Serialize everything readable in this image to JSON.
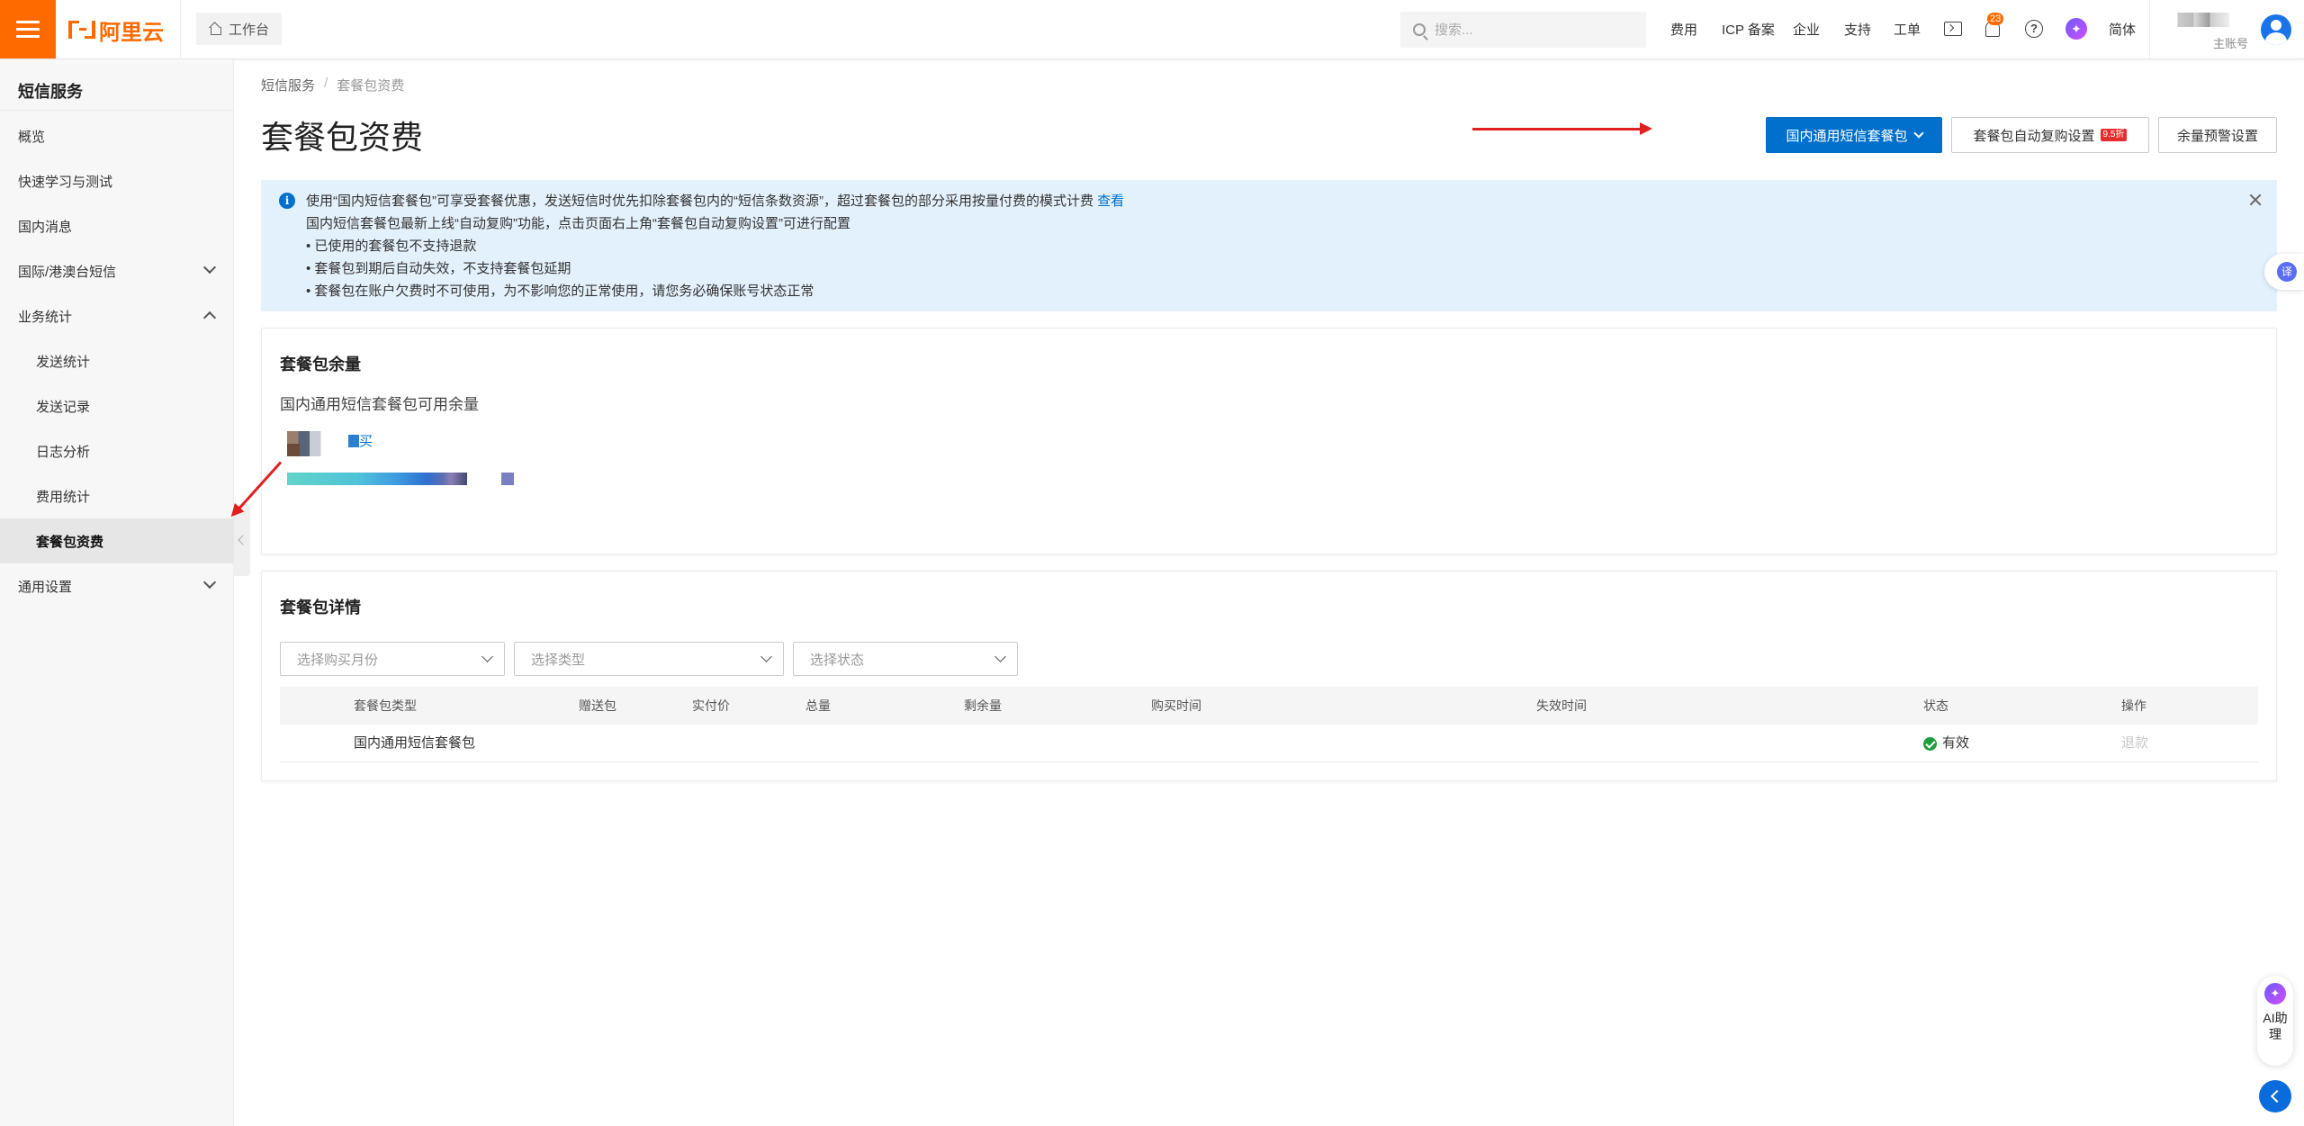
{
  "topbar": {
    "brand": "阿里云",
    "workbench": "工作台",
    "search_placeholder": "搜索...",
    "nav": [
      "费用",
      "ICP 备案",
      "企业",
      "支持",
      "工单"
    ],
    "notification_count": "23",
    "language": "简体",
    "account_role": "主账号"
  },
  "sidebar": {
    "title": "短信服务",
    "items": [
      {
        "label": "概览"
      },
      {
        "label": "快速学习与测试"
      },
      {
        "label": "国内消息"
      },
      {
        "label": "国际/港澳台短信"
      },
      {
        "label": "业务统计"
      },
      {
        "label": "发送统计"
      },
      {
        "label": "发送记录"
      },
      {
        "label": "日志分析"
      },
      {
        "label": "费用统计"
      },
      {
        "label": "套餐包资费"
      },
      {
        "label": "通用设置"
      }
    ]
  },
  "breadcrumb": {
    "root": "短信服务",
    "sep": "/",
    "current": "套餐包资费"
  },
  "page": {
    "title": "套餐包资费",
    "primary_button": "国内通用短信套餐包",
    "auto_renew_button": "套餐包自动复购设置",
    "discount_badge": "9.5折",
    "alert_button": "余量预警设置"
  },
  "notice": {
    "line1": "使用“国内短信套餐包”可享受套餐优惠，发送短信时优先扣除套餐包内的“短信条数资源”，超过套餐包的部分采用按量付费的模式计费",
    "line1_link": "查看",
    "line2": "国内短信套餐包最新上线“自动复购”功能，点击页面右上角“套餐包自动复购设置”可进行配置",
    "line3": "• 已使用的套餐包不支持退款",
    "line4": "• 套餐包到期后自动失效，不支持套餐包延期",
    "line5": "• 套餐包在账户欠费时不可使用，为不影响您的正常使用，请您务必确保账号状态正常"
  },
  "balance": {
    "title": "套餐包余量",
    "label": "国内通用短信套餐包可用余量",
    "buy_link": "买"
  },
  "details": {
    "title": "套餐包详情",
    "filters": [
      "选择购买月份",
      "选择类型",
      "选择状态"
    ],
    "columns": [
      "套餐包类型",
      "赠送包",
      "实付价",
      "总量",
      "剩余量",
      "购买时间",
      "失效时间",
      "状态",
      "操作"
    ],
    "rows": [
      {
        "type": "国内通用短信套餐包",
        "status": "有效",
        "action": "退款"
      }
    ]
  },
  "floating": {
    "translate": "译",
    "ai_assistant": "AI助理"
  }
}
